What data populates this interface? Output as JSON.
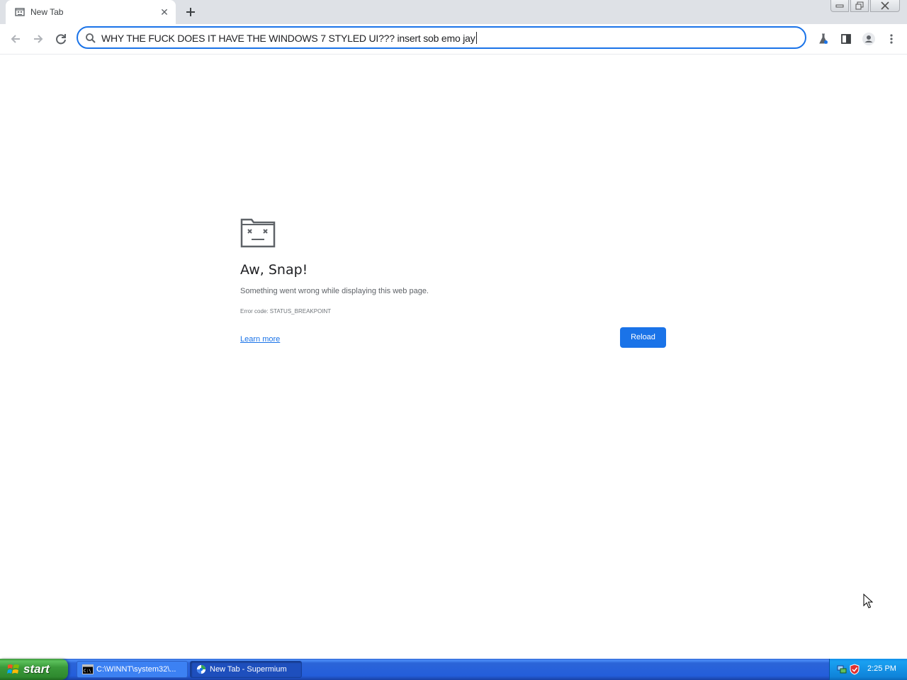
{
  "browser": {
    "tab": {
      "title": "New Tab",
      "favicon": "sad-tab-icon",
      "close_icon": "close-icon"
    },
    "new_tab_icon": "plus-icon",
    "window_controls": [
      "minimize-icon",
      "restore-icon",
      "close-icon"
    ],
    "toolbar": {
      "back_icon": "arrow-left-icon",
      "forward_icon": "arrow-right-icon",
      "reload_icon": "reload-icon",
      "omnibox": {
        "search_icon": "search-icon",
        "value": "WHY THE FUCK DOES IT HAVE THE WINDOWS 7 STYLED UI??? insert sob emo jay"
      },
      "right_icons": [
        "labs-flask-icon",
        "side-panel-icon",
        "profile-avatar-icon",
        "more-vert-icon"
      ]
    }
  },
  "crash_page": {
    "icon": "sad-tab-icon",
    "title": "Aw, Snap!",
    "description": "Something went wrong while displaying this web page.",
    "error_code": "Error code: STATUS_BREAKPOINT",
    "learn_more": "Learn more",
    "reload_button": "Reload"
  },
  "colors": {
    "accent": "#1a73e8",
    "tabstrip": "#dee1e6",
    "taskbar": "#245edb",
    "start_button": "#3a9a3a"
  },
  "taskbar": {
    "start_label": "start",
    "tasks": [
      {
        "label": "C:\\WINNT\\system32\\...",
        "icon": "command-prompt-icon",
        "active": false
      },
      {
        "label": "New Tab - Supermium",
        "icon": "supermium-icon",
        "active": true
      }
    ],
    "tray": {
      "icons": [
        "network-icon",
        "shield-icon"
      ],
      "clock": "2:25 PM"
    }
  }
}
